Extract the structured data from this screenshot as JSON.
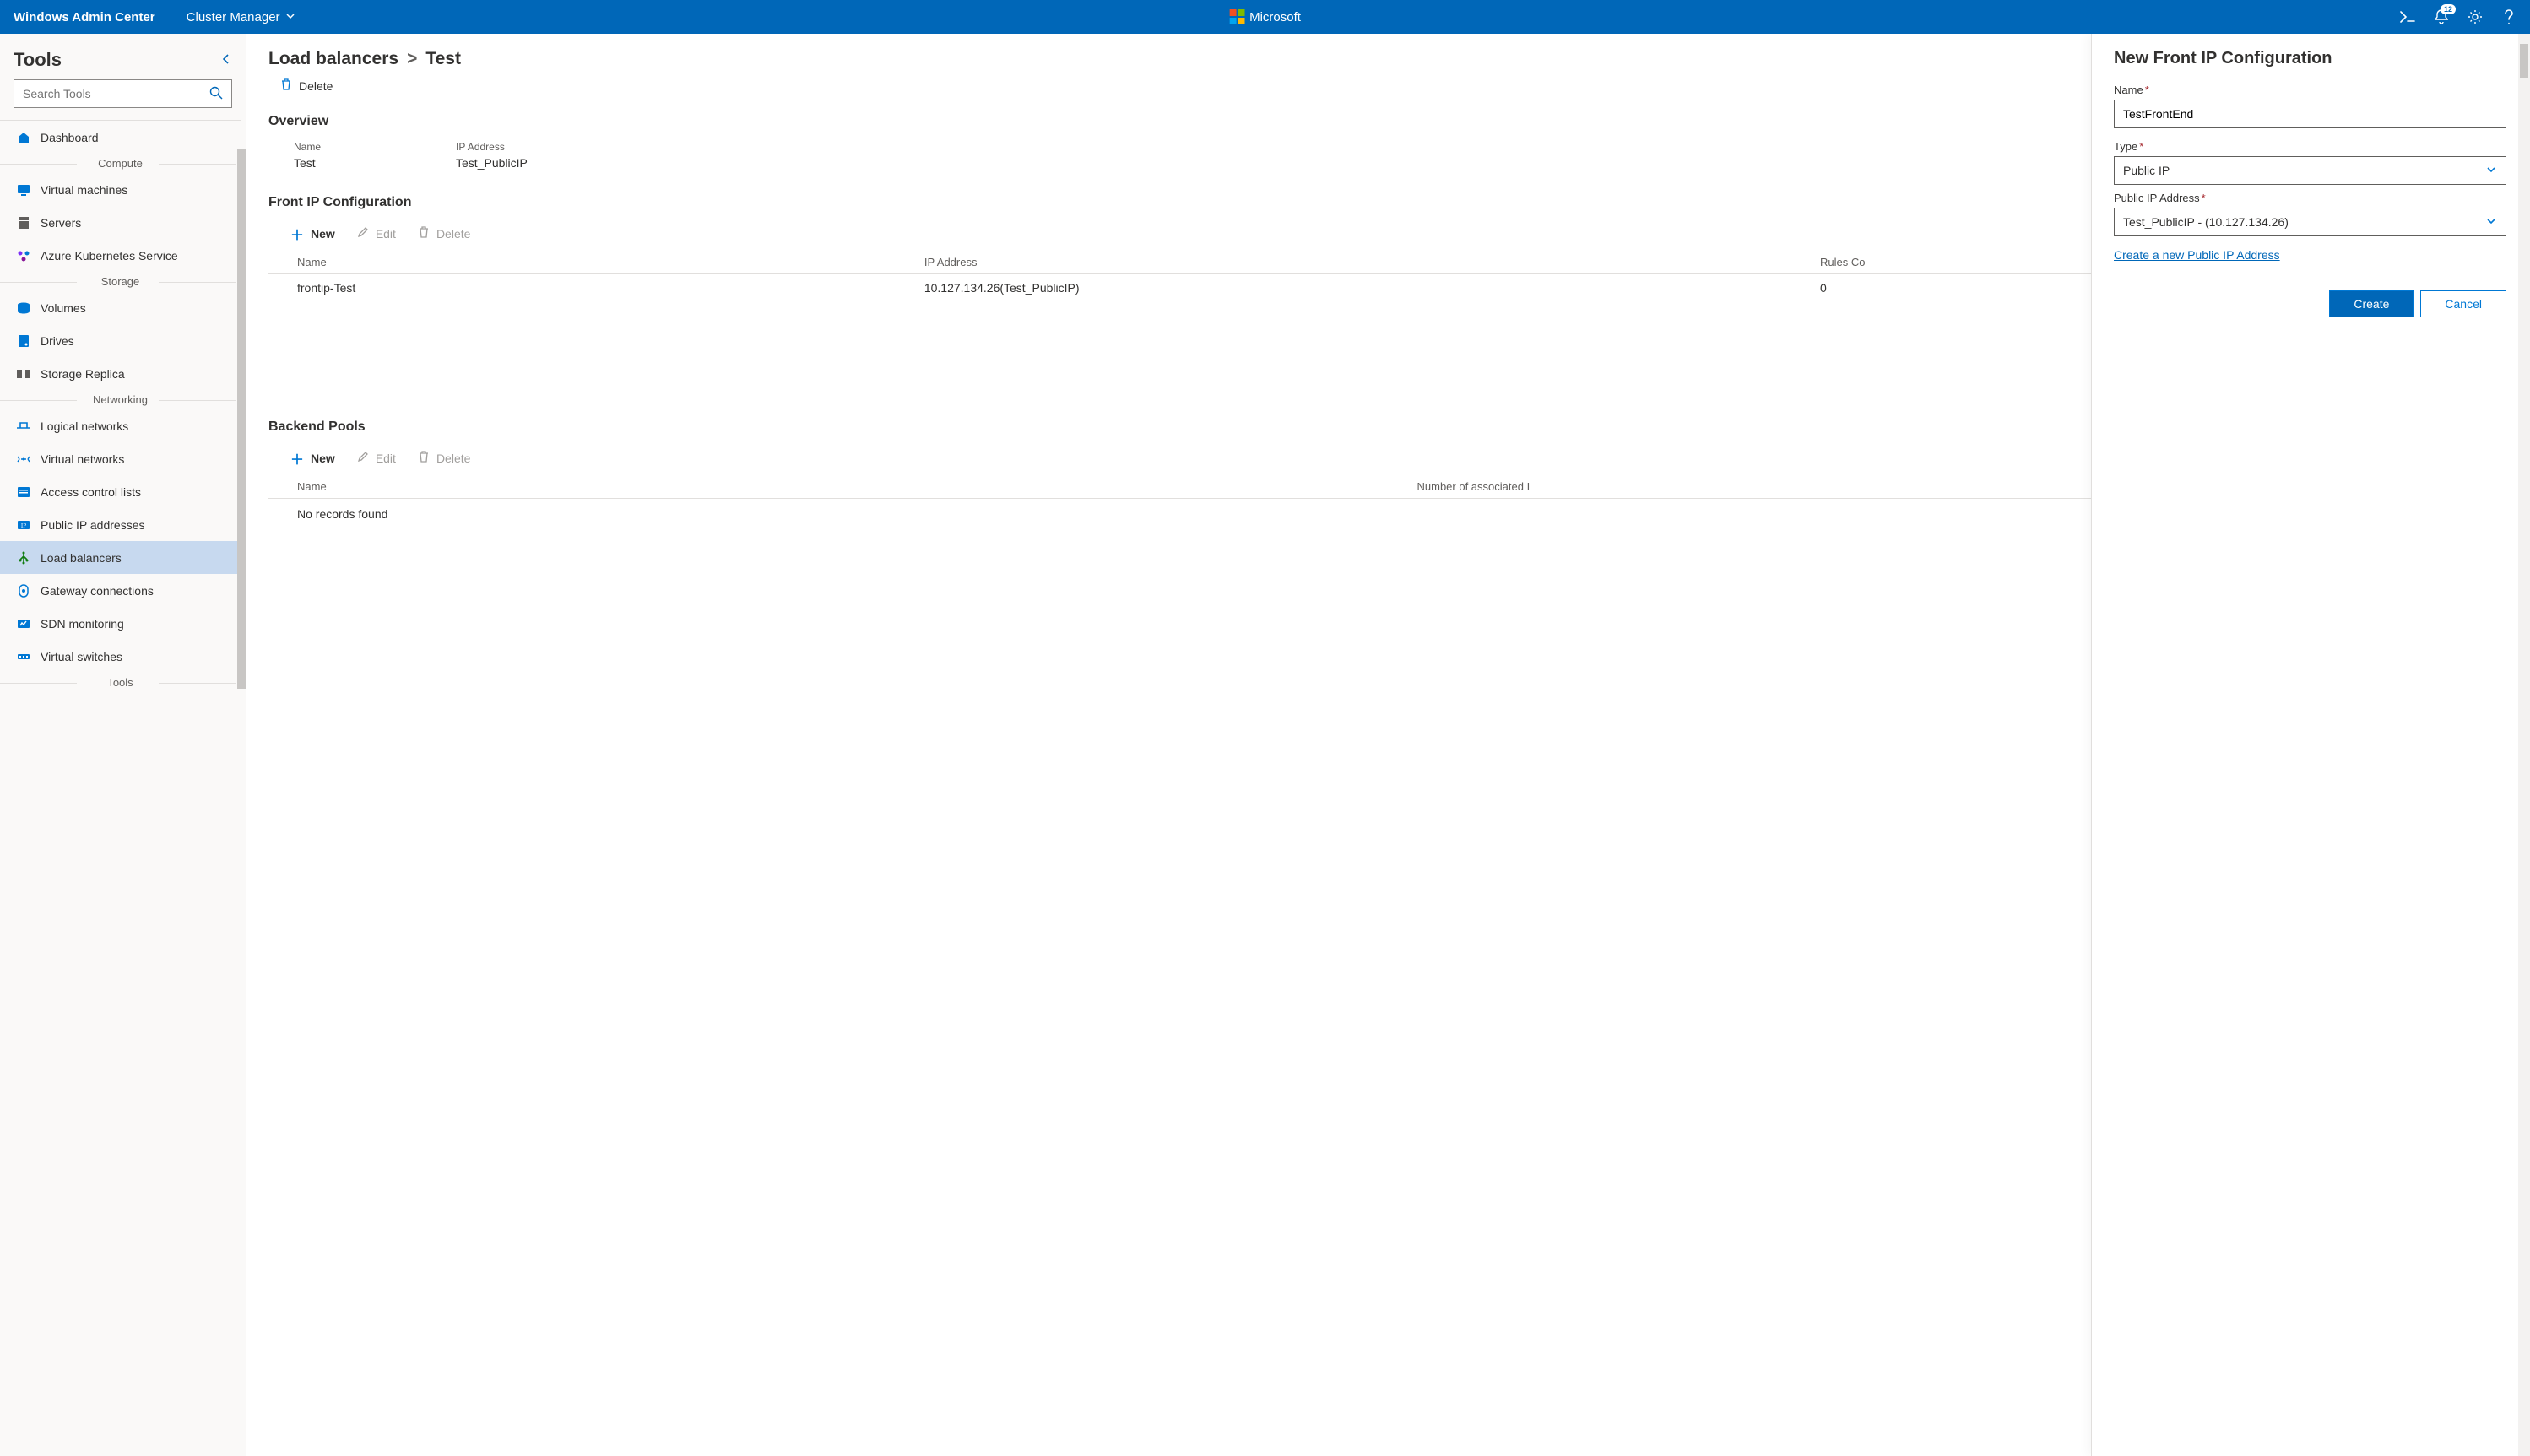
{
  "header": {
    "product": "Windows Admin Center",
    "context": "Cluster Manager",
    "brand": "Microsoft",
    "notification_count": "12"
  },
  "sidebar": {
    "title": "Tools",
    "search_placeholder": "Search Tools",
    "dashboard": "Dashboard",
    "groups": {
      "compute": "Compute",
      "storage": "Storage",
      "networking": "Networking",
      "tools": "Tools"
    },
    "items": {
      "vm": "Virtual machines",
      "servers": "Servers",
      "aks": "Azure Kubernetes Service",
      "volumes": "Volumes",
      "drives": "Drives",
      "storagereplica": "Storage Replica",
      "logicalnet": "Logical networks",
      "virtualnet": "Virtual networks",
      "acl": "Access control lists",
      "pip": "Public IP addresses",
      "lb": "Load balancers",
      "gw": "Gateway connections",
      "sdn": "SDN monitoring",
      "vswitch": "Virtual switches"
    }
  },
  "breadcrumb": {
    "root": "Load balancers",
    "current": "Test"
  },
  "actions": {
    "delete": "Delete"
  },
  "overview": {
    "title": "Overview",
    "name_label": "Name",
    "name_val": "Test",
    "ip_label": "IP Address",
    "ip_val": "Test_PublicIP"
  },
  "frontip": {
    "title": "Front IP Configuration",
    "toolbar": {
      "new": "New",
      "edit": "Edit",
      "delete": "Delete"
    },
    "cols": {
      "name": "Name",
      "ip": "IP Address",
      "rules": "Rules Co"
    },
    "row": {
      "name": "frontip-Test",
      "ip": "10.127.134.26(Test_PublicIP)",
      "rules": "0"
    }
  },
  "backend": {
    "title": "Backend Pools",
    "toolbar": {
      "new": "New",
      "edit": "Edit",
      "delete": "Delete"
    },
    "cols": {
      "name": "Name",
      "assoc": "Number of associated I"
    },
    "empty": "No records found"
  },
  "panel": {
    "title": "New Front IP Configuration",
    "name_label": "Name",
    "name_value": "TestFrontEnd",
    "type_label": "Type",
    "type_value": "Public IP",
    "pip_label": "Public IP Address",
    "pip_value": "Test_PublicIP - (10.127.134.26)",
    "link": "Create a new Public IP Address",
    "create": "Create",
    "cancel": "Cancel"
  }
}
